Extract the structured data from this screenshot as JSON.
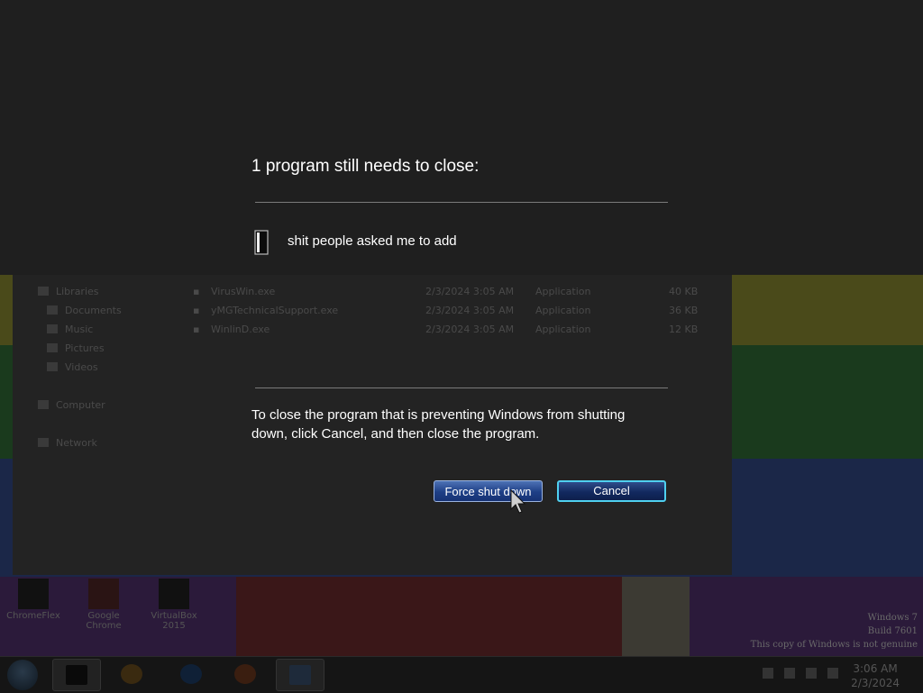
{
  "dialog": {
    "title": "1 program still needs to close:",
    "program_name": "shit people asked me to add",
    "message": "To close the program that is preventing Windows from shutting down, click Cancel, and then close the program.",
    "force_button": "Force shut down",
    "cancel_button": "Cancel"
  },
  "explorer": {
    "nav": [
      "Libraries",
      "Documents",
      "Music",
      "Pictures",
      "Videos",
      "Computer",
      "Network"
    ],
    "files": [
      {
        "name": "VirusWin.exe",
        "date": "2/3/2024 3:05 AM",
        "type": "Application",
        "size": "40 KB"
      },
      {
        "name": "yMGTechnicalSupport.exe",
        "date": "2/3/2024 3:05 AM",
        "type": "Application",
        "size": "36 KB"
      },
      {
        "name": "WinlinD.exe",
        "date": "2/3/2024 3:05 AM",
        "type": "Application",
        "size": "12 KB"
      }
    ]
  },
  "desktop_icons": [
    "ChromeFlex",
    "Google Chrome",
    "VirtualBox 2015"
  ],
  "watermark": {
    "line1": "Windows 7",
    "line2": "Build 7601",
    "line3": "This copy of Windows is not genuine"
  },
  "taskbar": {
    "time": "3:06 AM",
    "date": "2/3/2024"
  },
  "colors": {
    "button_primary": "#1e3f86",
    "button_focus_border": "#4fd0f0",
    "overlay": "#1e1e1e"
  }
}
